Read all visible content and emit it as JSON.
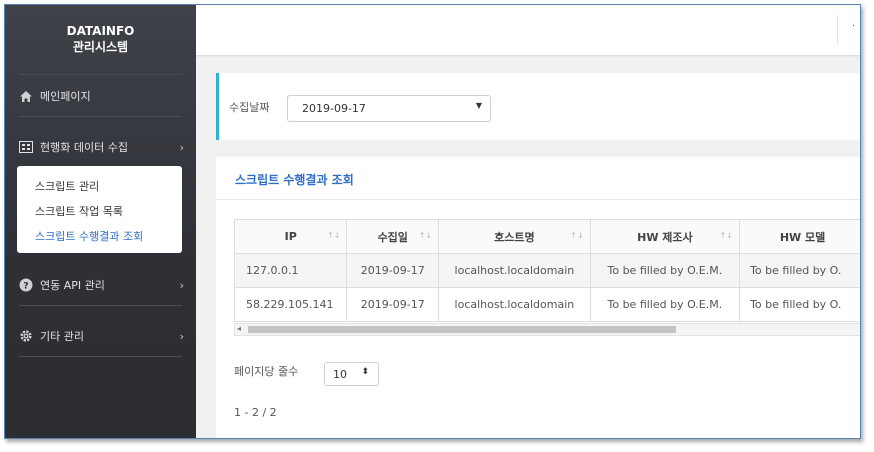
{
  "sidebar": {
    "brand_line1": "DATAINFO",
    "brand_line2": "관리시스템",
    "items": [
      {
        "label": "메인페이지",
        "icon": "home-icon"
      },
      {
        "label": "현행화 데이터 수집",
        "icon": "grid-icon"
      },
      {
        "label": "연동 API 관리",
        "icon": "question-icon"
      },
      {
        "label": "기타 관리",
        "icon": "gear-icon"
      }
    ],
    "submenu": [
      "스크립트 관리",
      "스크립트 작업 목록",
      "스크립트 수행결과 조회"
    ],
    "active_sub": "스크립트 수행결과 조회"
  },
  "filter": {
    "label": "수집날짜",
    "selected_date": "2019-09-17"
  },
  "panel": {
    "title": "스크립트 수행결과 조회"
  },
  "table": {
    "columns": [
      "IP",
      "수집일",
      "호스트명",
      "HW 제조사",
      "HW 모델"
    ],
    "rows": [
      [
        "127.0.0.1",
        "2019-09-17",
        "localhost.localdomain",
        "To be filled by O.E.M.",
        "To be filled by O."
      ],
      [
        "58.229.105.141",
        "2019-09-17",
        "localhost.localdomain",
        "To be filled by O.E.M.",
        "To be filled by O."
      ]
    ]
  },
  "pagination": {
    "per_page_label": "페이지당 줄수",
    "per_page_value": "10",
    "range_text": "1 - 2 / 2"
  },
  "colors": {
    "sidebar_bg": "#2e3036",
    "accent_blue": "#2f6fc5",
    "filter_border": "#2fb0d6"
  }
}
